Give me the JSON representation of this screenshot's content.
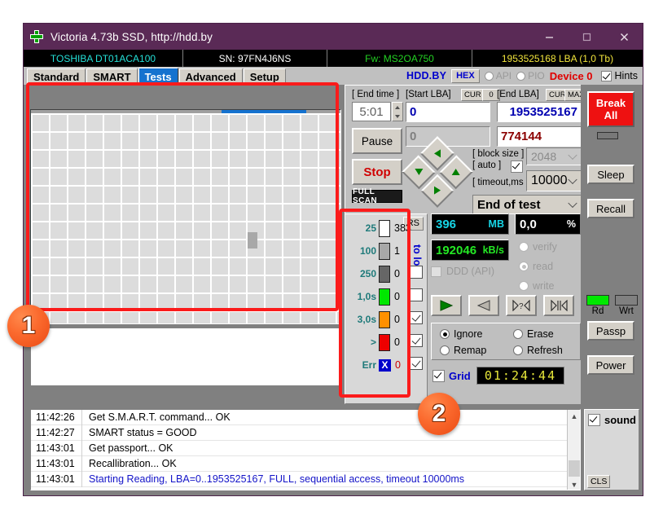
{
  "window": {
    "title": "Victoria 4.73b SSD, http://hdd.by",
    "icon": "green-cross-icon",
    "controls": {
      "minimize": "—",
      "maximize": "□",
      "close": "✕"
    }
  },
  "driveinfo": {
    "model": "TOSHIBA DT01ACA100",
    "serial": "SN: 97FN4J6NS",
    "firmware": "Fw: MS2OA750",
    "capacity": "1953525168 LBA (1,0 Tb)"
  },
  "tabs": [
    {
      "label": "Standard",
      "active": false
    },
    {
      "label": "SMART",
      "active": false
    },
    {
      "label": "Tests",
      "active": true
    },
    {
      "label": "Advanced",
      "active": false
    },
    {
      "label": "Setup",
      "active": false
    }
  ],
  "tabbar_right": {
    "brand": "HDD.BY",
    "hex_button": "HEX",
    "api_radio": "API",
    "pio_radio": "PIO",
    "device": "Device 0",
    "hints_label": "Hints",
    "hints_checked": true
  },
  "scan": {
    "end_time_label": "[ End time ]",
    "end_time_value": "5:01",
    "start_lba_label": "[Start LBA]",
    "start_lba_cur": "CUR",
    "start_lba_zero": "0",
    "start_lba_value": "0",
    "start_lba_secondary": "0",
    "end_lba_label": "[End LBA]",
    "end_lba_cur": "CUR",
    "end_lba_max": "MAX",
    "end_lba_value": "1953525167",
    "end_lba_secondary": "774144",
    "pause_button": "Pause",
    "stop_button": "Stop",
    "full_scan_button": "FULL SCAN",
    "block_size_label": "[ block size ]",
    "auto_label": "[ auto ]",
    "auto_checked": true,
    "block_size_value": "2048",
    "timeout_label": "[ timeout,ms ]",
    "timeout_value": "10000",
    "end_action_value": "End of test"
  },
  "legend": {
    "rs_button": "RS",
    "to_log_label": "to log:",
    "rows": [
      {
        "name": "25",
        "color": "#ffffff",
        "value": "383",
        "checkbox": null
      },
      {
        "name": "100",
        "color": "#a8a8a8",
        "value": "1",
        "checkbox": null
      },
      {
        "name": "250",
        "color": "#666666",
        "value": "0",
        "checkbox": false
      },
      {
        "name": "1,0s",
        "color": "#00e800",
        "value": "0",
        "checkbox": false
      },
      {
        "name": "3,0s",
        "color": "#ff9000",
        "value": "0",
        "checkbox": true
      },
      {
        "name": ">",
        "color": "#ee0000",
        "value": "0",
        "checkbox": true
      },
      {
        "name": "Err",
        "color": "#0000cc",
        "value": "0",
        "checkbox": true,
        "glyph": "X"
      }
    ]
  },
  "stats": {
    "size_value": "396",
    "size_unit": "MB",
    "percent_value": "0,0",
    "percent_unit": "%",
    "speed_value": "192046",
    "speed_unit": "kB/s",
    "ddd_label": "DDD (API)",
    "ddd_checked": false,
    "modes": [
      {
        "label": "verify",
        "selected": false
      },
      {
        "label": "read",
        "selected": true
      },
      {
        "label": "write",
        "selected": false
      }
    ],
    "transport": [
      {
        "icon": "play-icon"
      },
      {
        "icon": "reverse-icon"
      },
      {
        "icon": "seek-unknown-icon"
      },
      {
        "icon": "seek-end-icon"
      }
    ],
    "actions": [
      {
        "label": "Ignore",
        "selected": true
      },
      {
        "label": "Erase",
        "selected": false
      },
      {
        "label": "Remap",
        "selected": false
      },
      {
        "label": "Refresh",
        "selected": false
      }
    ],
    "grid_label": "Grid",
    "grid_checked": true,
    "timer": "01:24:44"
  },
  "sidebar": {
    "break_all": "Break\nAll",
    "break_line1": "Break",
    "break_line2": "All",
    "sleep": "Sleep",
    "recall": "Recall",
    "rd_label": "Rd",
    "wrt_label": "Wrt",
    "rd_color": "#00e800",
    "wrt_color": "#808080",
    "passp": "Passp",
    "power": "Power"
  },
  "sound": {
    "label": "sound",
    "checked": true,
    "cls_button": "CLS"
  },
  "log": {
    "rows": [
      {
        "time": "11:42:26",
        "message": "Get S.M.A.R.T. command... OK",
        "highlight": false
      },
      {
        "time": "11:42:27",
        "message": "SMART status = GOOD",
        "highlight": false
      },
      {
        "time": "11:43:01",
        "message": "Get passport... OK",
        "highlight": false
      },
      {
        "time": "11:43:01",
        "message": "Recallibration... OK",
        "highlight": false
      },
      {
        "time": "11:43:01",
        "message": "Starting Reading, LBA=0..1953525167, FULL, sequential access, timeout 10000ms",
        "highlight": true
      }
    ]
  },
  "annotations": [
    {
      "number": "1",
      "target": "grid-map-panel"
    },
    {
      "number": "2",
      "target": "legend-panel"
    }
  ],
  "colors": {
    "titlebar": "#5a2a56",
    "accent_red": "#fb1b1b",
    "badge_orange": "#fb6a2e",
    "tab_active": "#1572cf"
  }
}
